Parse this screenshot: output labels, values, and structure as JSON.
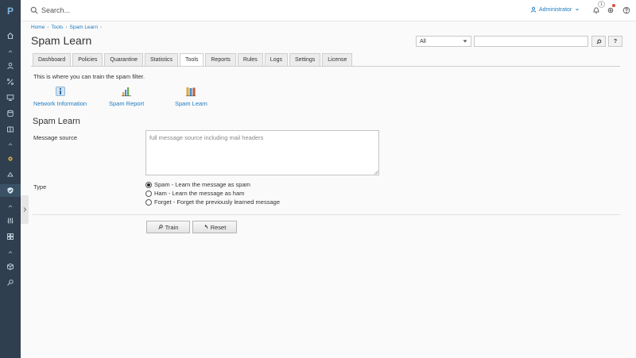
{
  "sidebar": {
    "logo": "P",
    "items": [
      {
        "icon": "home-icon"
      },
      {
        "icon": "chevron-up-icon"
      },
      {
        "icon": "user-icon"
      },
      {
        "icon": "percent-icon"
      },
      {
        "icon": "monitor-icon"
      },
      {
        "icon": "database-icon"
      },
      {
        "icon": "book-icon"
      },
      {
        "icon": "chevron-up-icon"
      },
      {
        "icon": "gear-icon"
      },
      {
        "icon": "recycle-icon"
      },
      {
        "icon": "shield-icon"
      },
      {
        "icon": "chevron-up-icon"
      },
      {
        "icon": "sliders-icon"
      },
      {
        "icon": "grid-icon"
      },
      {
        "icon": "chevron-up-icon"
      },
      {
        "icon": "box-icon"
      },
      {
        "icon": "wrench-icon"
      }
    ]
  },
  "topbar": {
    "search_placeholder": "Search...",
    "user_label": "Administrator",
    "notification_count": "1"
  },
  "breadcrumb": [
    "Home",
    "Tools",
    "Spam Learn"
  ],
  "page_title": "Spam Learn",
  "filter": {
    "select_value": "All",
    "search_value": ""
  },
  "tabs": [
    "Dashboard",
    "Policies",
    "Quarantine",
    "Statistics",
    "Tools",
    "Reports",
    "Rules",
    "Logs",
    "Settings",
    "License"
  ],
  "active_tab": "Tools",
  "intro_text": "This is where you can train the spam filter.",
  "tools": [
    {
      "label": "Network Information",
      "icon": "network-info-icon"
    },
    {
      "label": "Spam Report",
      "icon": "spam-report-icon"
    },
    {
      "label": "Spam Learn",
      "icon": "spam-learn-icon"
    }
  ],
  "section_title": "Spam Learn",
  "form": {
    "message_source_label": "Message source",
    "message_source_placeholder": "full message source including mail headers",
    "type_label": "Type",
    "options": [
      {
        "label": "Spam - Learn the message as spam",
        "checked": true
      },
      {
        "label": "Ham - Learn the message as ham",
        "checked": false
      },
      {
        "label": "Forget - Forget the previously learned message",
        "checked": false
      }
    ],
    "train_label": "Train",
    "reset_label": "Reset"
  },
  "colors": {
    "sidebar_bg": "#2f3f4f",
    "link": "#1e7bbf",
    "page_bg": "#fafafa"
  }
}
